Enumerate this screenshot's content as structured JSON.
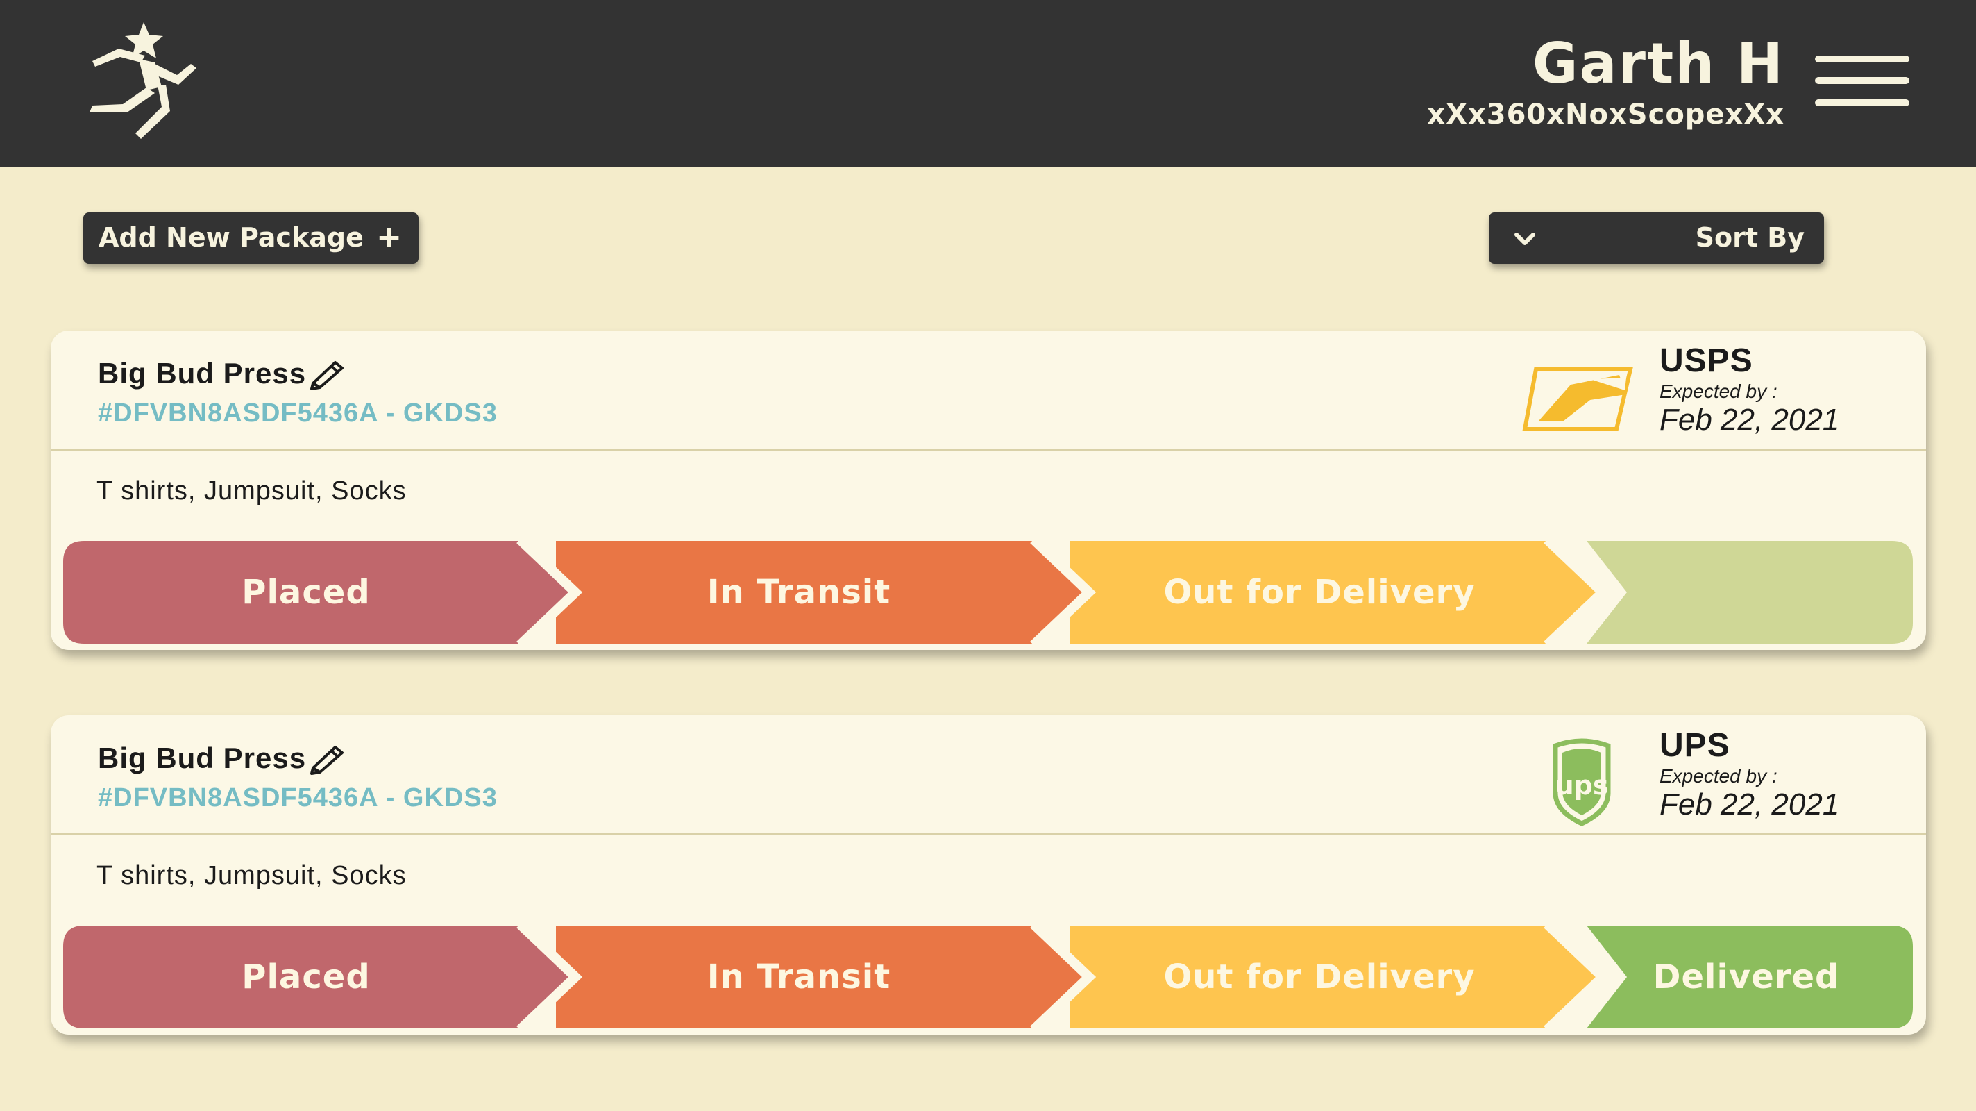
{
  "header": {
    "logo_icon": "running-star-figure-icon",
    "user_name": "Garth H",
    "user_handle": "xXx360xNoxScopexXx",
    "menu_icon": "hamburger-menu-icon"
  },
  "toolbar": {
    "add_label": "Add New Package",
    "add_icon": "+",
    "sort_label": "Sort By",
    "sort_icon": "chevron-down-icon"
  },
  "colors": {
    "placed": "#c0676c",
    "in_transit": "#e97645",
    "out_for_delivery": "#fec54f",
    "delivered": "#8cbd5d",
    "pending": "#cfd796",
    "tracking": "#75bcc4"
  },
  "packages": [
    {
      "store": "Big Bud Press",
      "tracking": "#DFVBN8ASDF5436A - GKDS3",
      "items": "T shirts, Jumpsuit, Socks",
      "carrier": "USPS",
      "carrier_icon": "usps-eagle-logo-icon",
      "expected_label": "Expected by :",
      "expected_date": "Feb 22, 2021",
      "stages": [
        "Placed",
        "In Transit",
        "Out for Delivery",
        ""
      ],
      "delivered": false
    },
    {
      "store": "Big Bud Press",
      "tracking": "#DFVBN8ASDF5436A - GKDS3",
      "items": "T shirts, Jumpsuit, Socks",
      "carrier": "UPS",
      "carrier_icon": "ups-shield-logo-icon",
      "expected_label": "Expected by :",
      "expected_date": "Feb 22, 2021",
      "stages": [
        "Placed",
        "In Transit",
        "Out for Delivery",
        "Delivered"
      ],
      "delivered": true
    }
  ]
}
